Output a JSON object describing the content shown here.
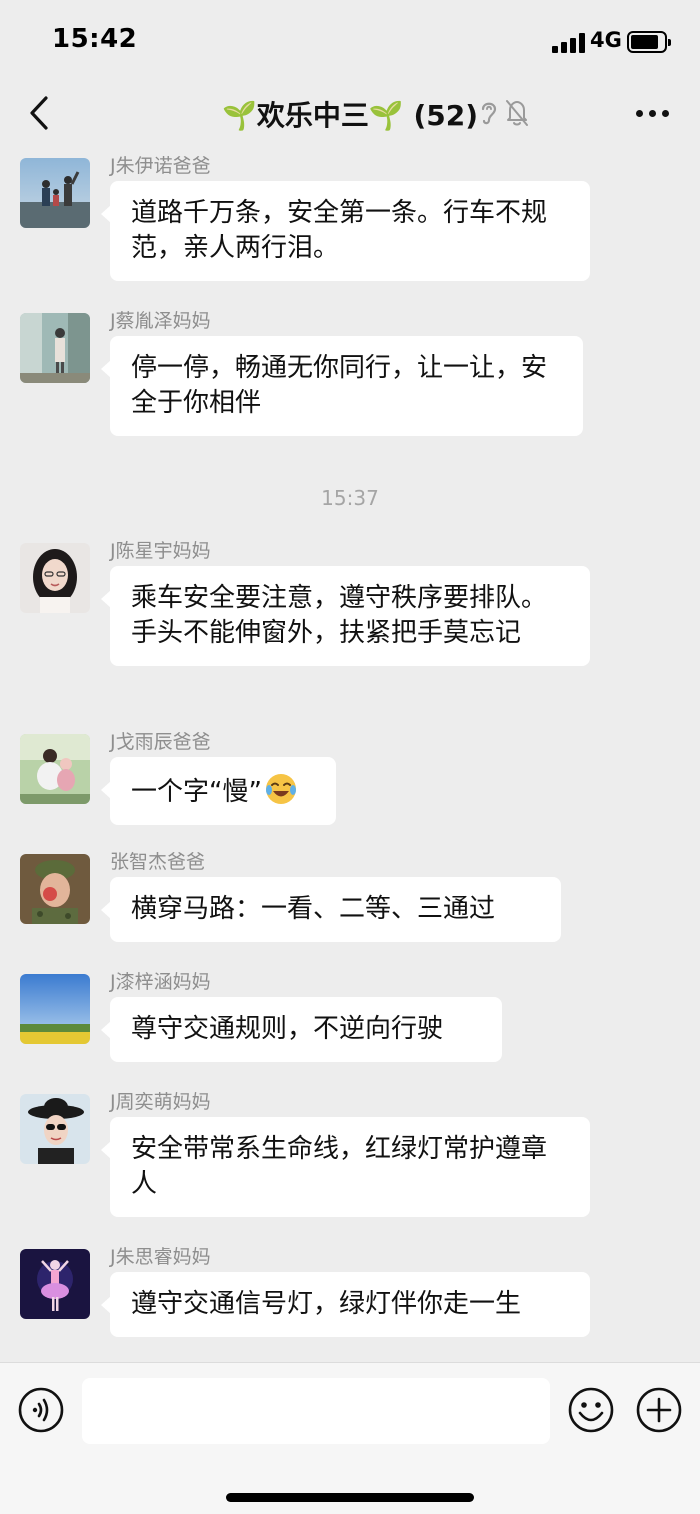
{
  "status_bar": {
    "time": "15:42",
    "network": "4G"
  },
  "nav": {
    "title": "🌱欢乐中三🌱 (52)",
    "back_icon": "chevron-left-icon",
    "more_icon": "more-dots-icon"
  },
  "chat": {
    "messages": [
      {
        "sender": "J朱伊诺爸爸",
        "text": "道路千万条，安全第一条。行车不规范，亲人两行泪。"
      },
      {
        "sender": "J蔡胤泽妈妈",
        "text": "停一停，畅通无你同行，让一让，安全于你相伴"
      },
      {
        "sender": "J陈星宇妈妈",
        "text": "乘车安全要注意，遵守秩序要排队。手头不能伸窗外，扶紧把手莫忘记"
      },
      {
        "sender": "J戈雨辰爸爸",
        "text": "一个字“慢”"
      },
      {
        "sender": "张智杰爸爸",
        "text": "横穿马路：一看、二等、三通过"
      },
      {
        "sender": "J漆梓涵妈妈",
        "text": "尊守交通规则，不逆向行驶"
      },
      {
        "sender": "J周奕萌妈妈",
        "text": "安全带常系生命线，红绿灯常护遵章人"
      },
      {
        "sender": "J朱思睿妈妈",
        "text": "遵守交通信号灯，绿灯伴你走一生"
      }
    ],
    "time_divider": "15:37"
  },
  "input_bar": {
    "voice_icon": "voice-icon",
    "emoji_icon": "emoji-icon",
    "plus_icon": "plus-icon"
  },
  "colors": {
    "background": "#ededed",
    "bubble": "#ffffff",
    "sender_text": "#8e8e8e"
  }
}
